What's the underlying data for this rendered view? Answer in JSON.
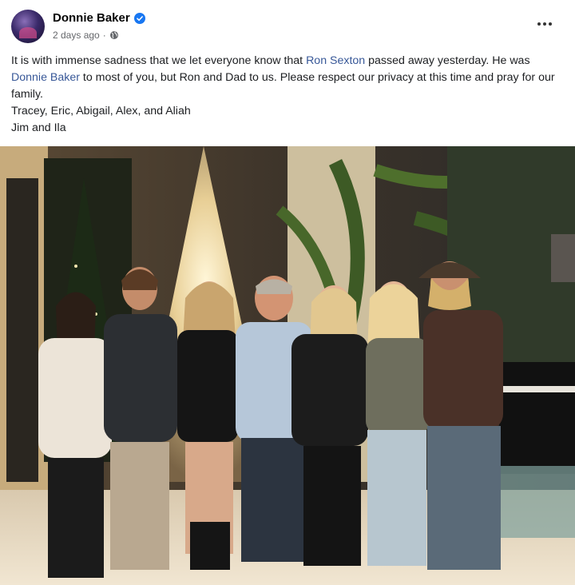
{
  "post": {
    "author": "Donnie Baker",
    "timestamp": "2 days ago",
    "separator": "·",
    "privacy_icon": "globe-icon",
    "verified_icon": "verified-badge-icon",
    "more_icon": "more-options-icon",
    "message": {
      "part1": "It is with immense sadness that we let everyone know that ",
      "link1": "Ron Sexton",
      "part2": " passed away yesterday. He was ",
      "link2": "Donnie Baker",
      "part3": " to most of you, but Ron and Dad to us. Please respect our privacy at this time and pray for our family.",
      "line2": "Tracey, Eric, Abigail, Alex, and Aliah",
      "line3": "Jim and Ila"
    }
  },
  "colors": {
    "link": "#385898",
    "text": "#1c1e21",
    "meta": "#65676b",
    "verified": "#1877f2"
  }
}
